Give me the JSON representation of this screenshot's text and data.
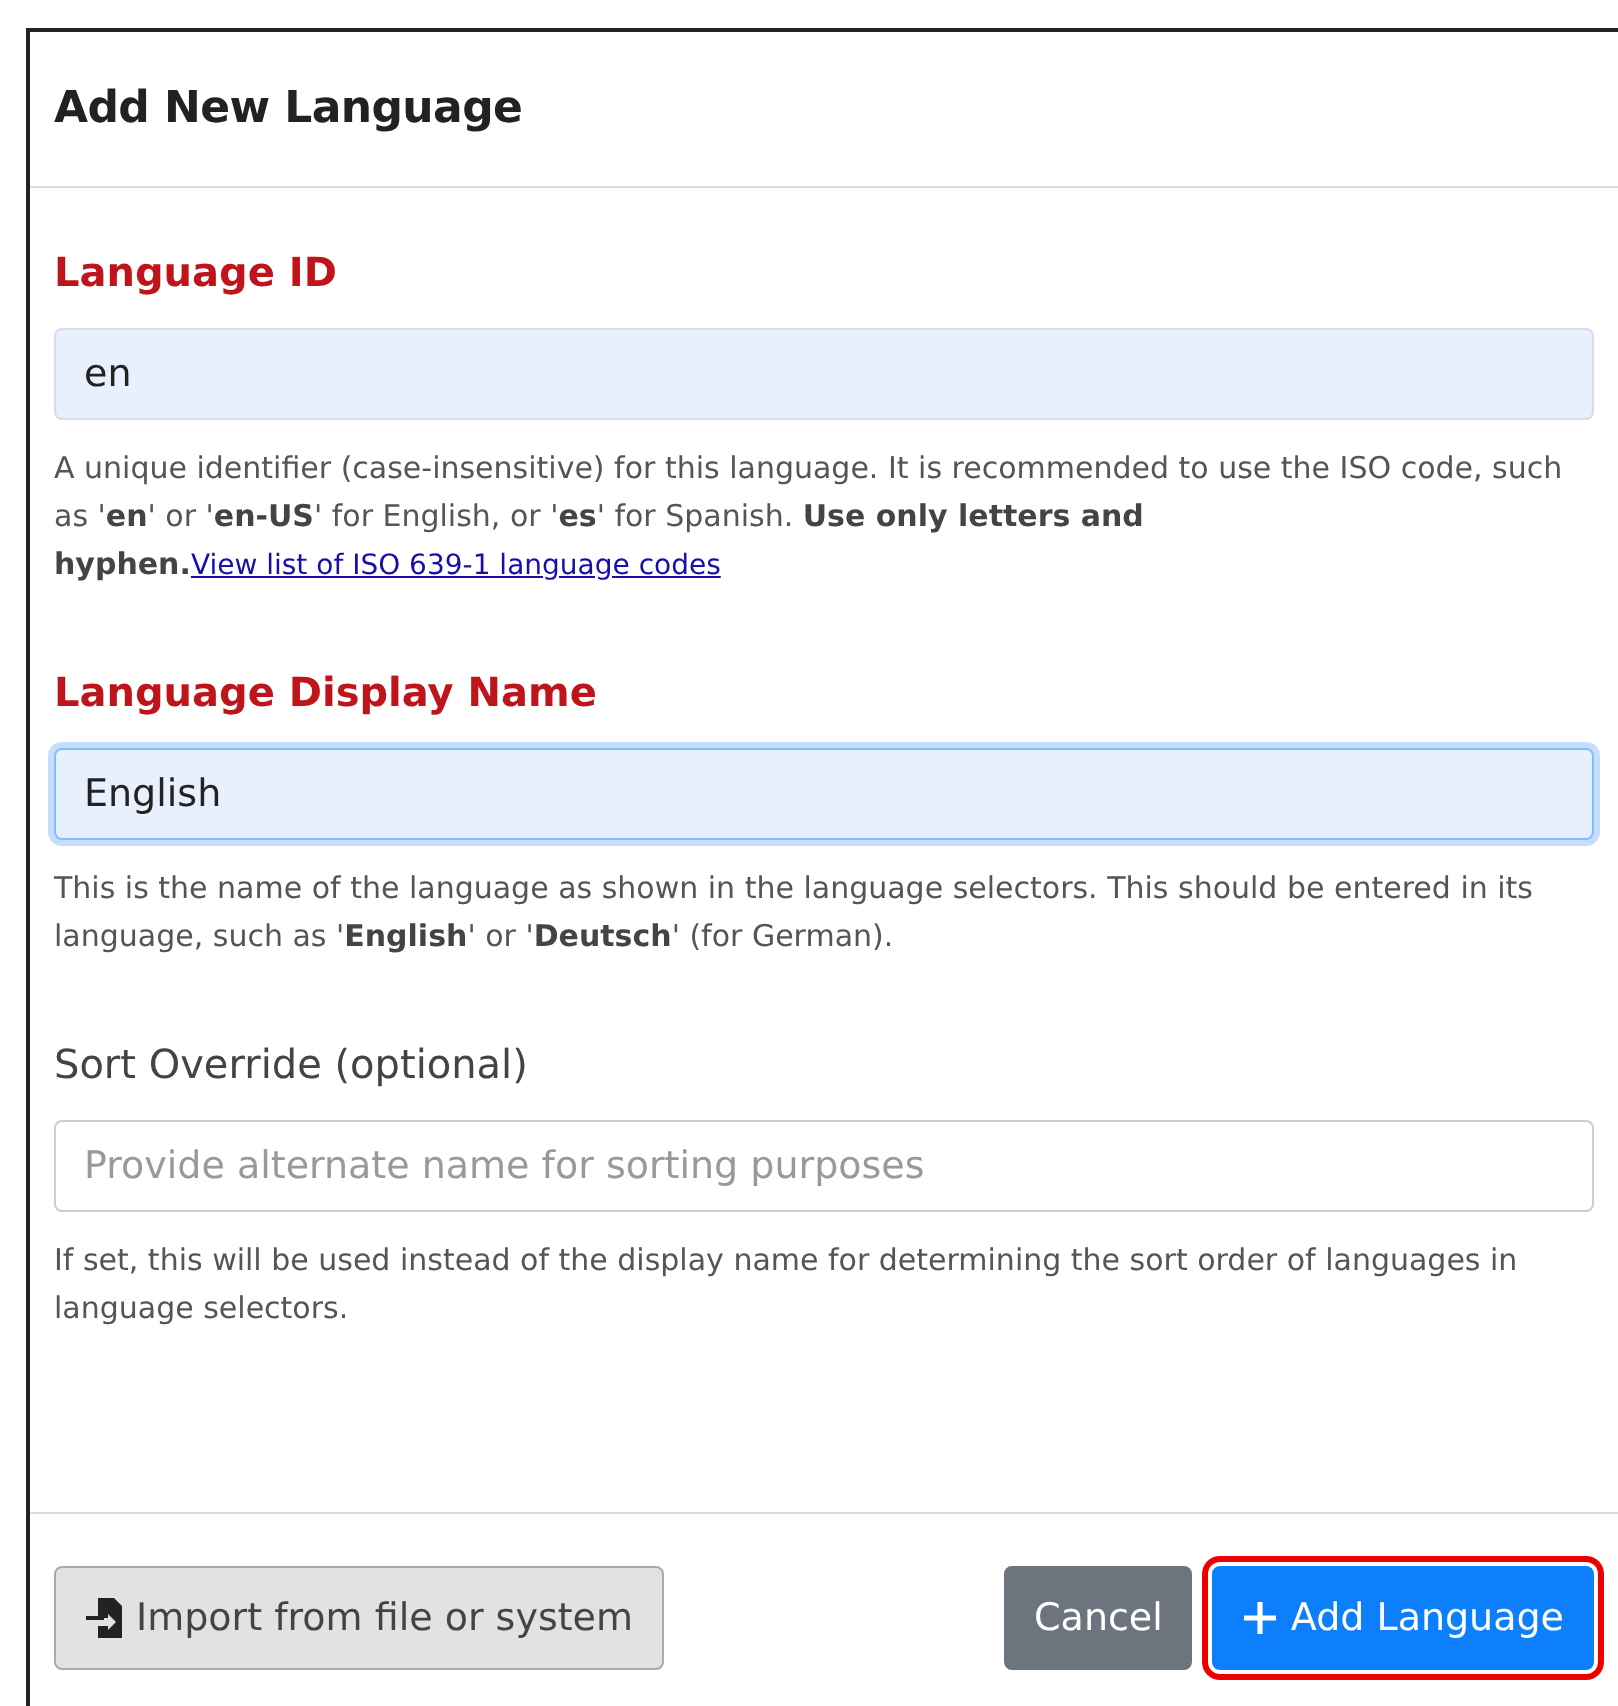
{
  "dialog": {
    "title": "Add New Language"
  },
  "fields": [
    {
      "label": "Language ID",
      "required": true,
      "value": "en",
      "focused": false,
      "help": "A unique identifier (case-insensitive) for this language. It is recommended to use the ISO code, such as '**en**' or '**en-US**' for English, or '**es**' for Spanish. **Use only letters and hyphen.**",
      "link": "View list of ISO 639-1 language codes"
    },
    {
      "label": "Language Display Name",
      "required": true,
      "value": "English",
      "focused": true,
      "help": "This is the name of the language as shown in the language selectors. This should be entered in its language, such as '**English**' or '**Deutsch**' (for German)."
    },
    {
      "label": "Sort Override (optional)",
      "required": false,
      "placeholder": "Provide alternate name for sorting purposes",
      "focused": false,
      "help": "If set, this will be used instead of the display name for determining the sort order of languages in language selectors."
    }
  ],
  "buttons": [
    {
      "kind": "import",
      "label": "Import from file or system",
      "highlighted": false
    },
    {
      "kind": "cancel",
      "label": "Cancel",
      "highlighted": false
    },
    {
      "kind": "add",
      "label": "Add Language",
      "highlighted": true
    }
  ]
}
